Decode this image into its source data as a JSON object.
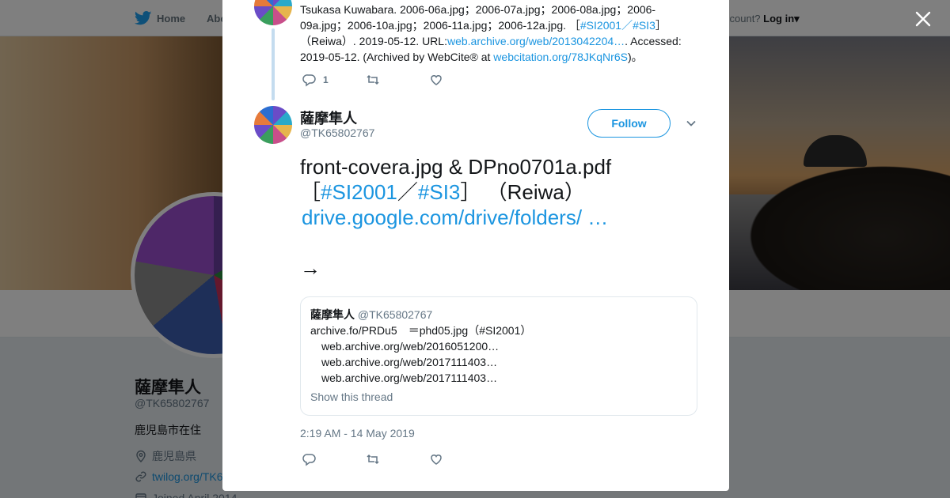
{
  "nav": {
    "home_label": "Home",
    "about_label": "Abo",
    "account_text": "ccount?",
    "login_label": "Log in"
  },
  "profile": {
    "name": "薩摩隼人",
    "handle": "@TK65802767",
    "bio": "鹿児島市在住",
    "location": "鹿児島県",
    "website": "twilog.org/TK6",
    "joined": "Joined April 2014"
  },
  "previous_tweet": {
    "text_plain_1": "Tsukasa Kuwabara. 2006-06a.jpg；2006-07a.jpg；2006-08a.jpg；2006-09a.jpg；2006-10a.jpg；2006-11a.jpg；2006-12a.jpg. ［",
    "hashtag_1": "#SI2001",
    "separator": "／",
    "hashtag_2": "#SI3",
    "text_plain_2": "］（Reiwa）. 2019-05-12. URL:",
    "url_1": "web.archive.org/web/2013042204…",
    "text_plain_3": ". Accessed: 2019-05-12. (Archived by WebCite® at ",
    "url_2": "webcitation.org/78JKqNr6S",
    "text_plain_4": ")。",
    "reply_count": "1"
  },
  "tweet": {
    "name": "薩摩隼人",
    "handle": "@TK65802767",
    "follow_label": "Follow",
    "text_line_1": "front-covera.jpg & DPno0701a.pdf",
    "bracket_open": "［",
    "hashtag_1": "#SI2001",
    "separator": "／",
    "hashtag_2": "#SI3",
    "bracket_close_reiwa": "］ （Reiwa）",
    "link": "drive.google.com/drive/folders/ …",
    "arrow": "→",
    "timestamp": "2:19 AM - 14 May 2019"
  },
  "quote": {
    "name": "薩摩隼人",
    "handle": "@TK65802767",
    "line_1": "archive.fo/PRDu5　＝phd05.jpg（#SI2001）",
    "line_2": "web.archive.org/web/2016051200…",
    "line_3": "web.archive.org/web/2017111403…",
    "line_4": "web.archive.org/web/2017111403…",
    "show_thread": "Show this thread"
  }
}
